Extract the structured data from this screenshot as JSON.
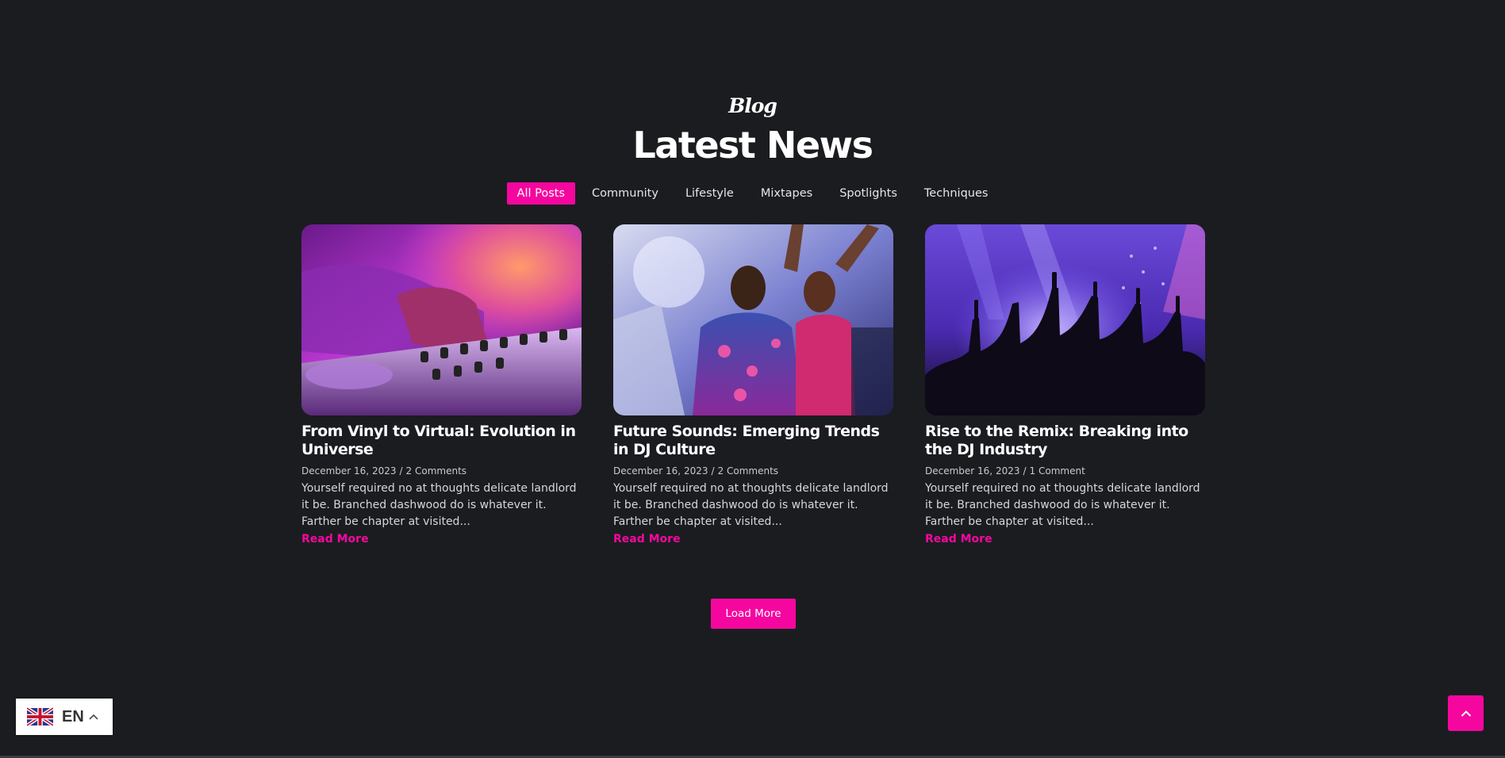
{
  "section": {
    "kicker": "Blog",
    "title": "Latest News"
  },
  "filters": [
    {
      "label": "All Posts",
      "active": true
    },
    {
      "label": "Community",
      "active": false
    },
    {
      "label": "Lifestyle",
      "active": false
    },
    {
      "label": "Mixtapes",
      "active": false
    },
    {
      "label": "Spotlights",
      "active": false
    },
    {
      "label": "Techniques",
      "active": false
    }
  ],
  "posts": [
    {
      "title": "From Vinyl to Virtual: Evolution in Universe",
      "date": "December 16, 2023",
      "separator": "/",
      "comments": "2 Comments",
      "excerpt": "Yourself required no at thoughts delicate landlord it be. Branched dashwood do is whatever it. Farther be chapter at visited...",
      "read_more": "Read More"
    },
    {
      "title": "Future Sounds: Emerging Trends in DJ Culture",
      "date": "December 16, 2023",
      "separator": "/",
      "comments": "2 Comments",
      "excerpt": "Yourself required no at thoughts delicate landlord it be. Branched dashwood do is whatever it. Farther be chapter at visited...",
      "read_more": "Read More"
    },
    {
      "title": "Rise to the Remix: Breaking into the DJ Industry",
      "date": "December 16, 2023",
      "separator": "/",
      "comments": "1 Comment",
      "excerpt": "Yourself required no at thoughts delicate landlord it be. Branched dashwood do is whatever it. Farther be chapter at visited...",
      "read_more": "Read More"
    }
  ],
  "load_more": "Load More",
  "language": {
    "code": "EN",
    "flag_icon": "uk-flag-icon",
    "chevron_icon": "chevron-up-icon"
  },
  "scroll_top_icon": "chevron-up-icon",
  "colors": {
    "background": "#1b1c20",
    "accent": "#f5079f",
    "text": "#ffffff",
    "muted": "#c9c9cf"
  }
}
